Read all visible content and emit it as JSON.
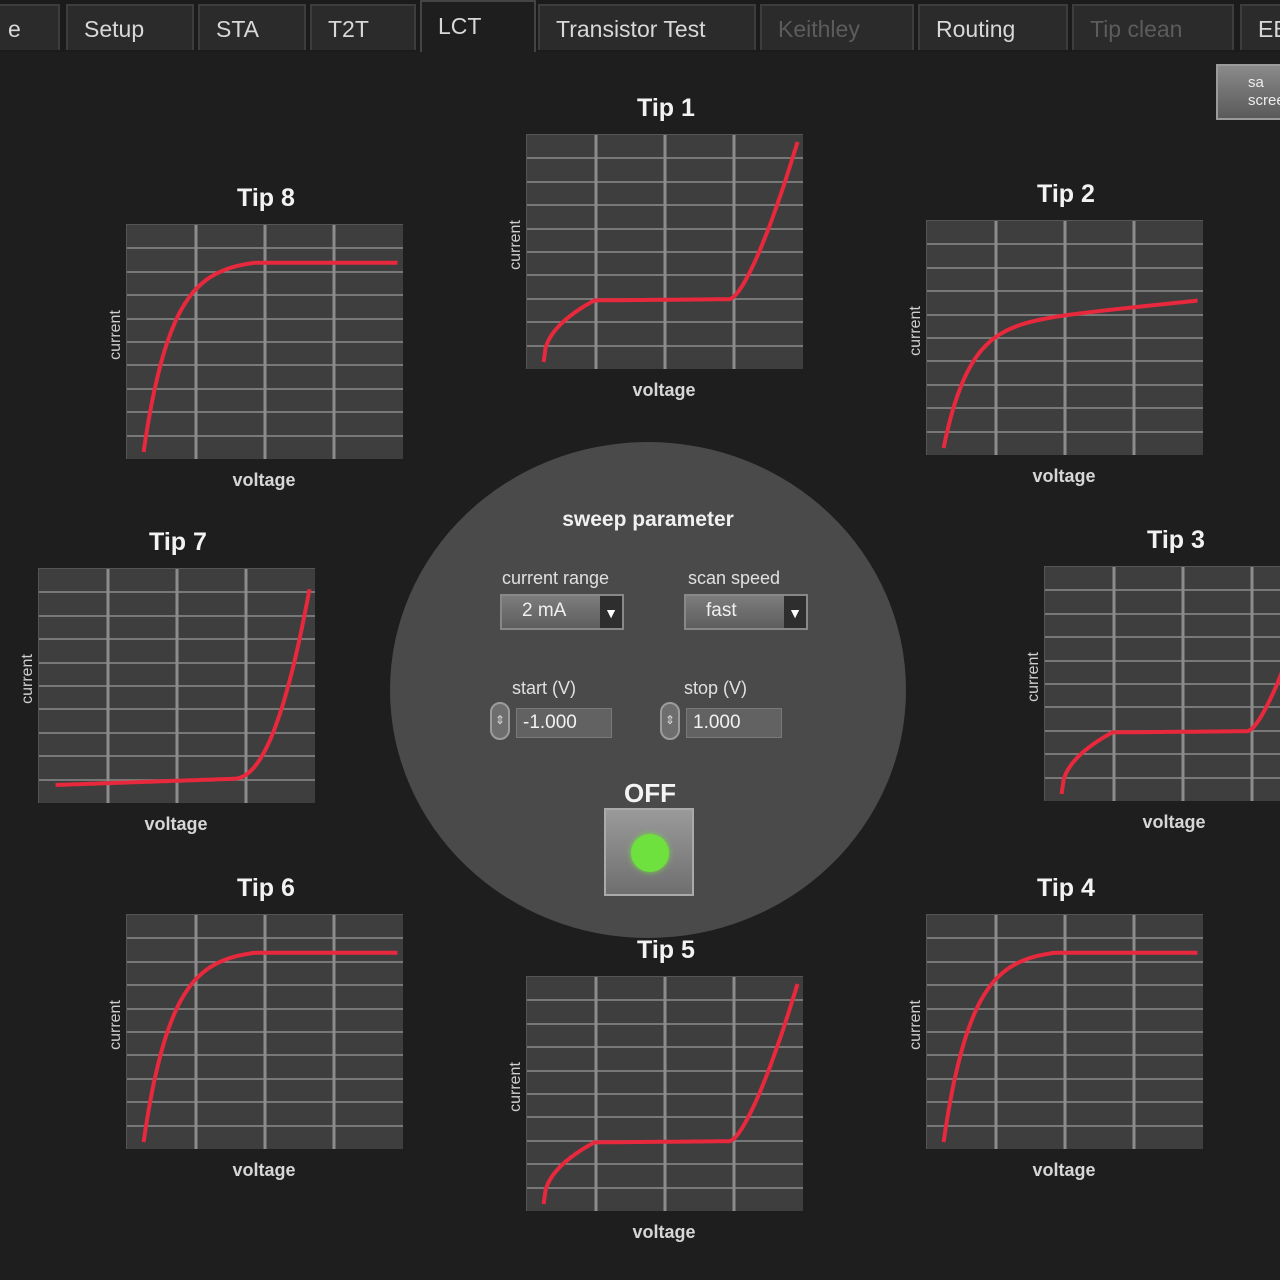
{
  "tabs": [
    {
      "label": "e",
      "state": "normal"
    },
    {
      "label": "Setup",
      "state": "normal"
    },
    {
      "label": "STA",
      "state": "normal"
    },
    {
      "label": "T2T",
      "state": "normal"
    },
    {
      "label": "LCT",
      "state": "active"
    },
    {
      "label": "Transistor Test",
      "state": "normal"
    },
    {
      "label": "Keithley",
      "state": "disabled"
    },
    {
      "label": "Routing",
      "state": "normal"
    },
    {
      "label": "Tip clean",
      "state": "disabled"
    },
    {
      "label": "EB",
      "state": "normal"
    }
  ],
  "save_button": {
    "label": "sa scree"
  },
  "tips": [
    {
      "title": "Tip 1",
      "ylabel": "current",
      "xlabel": "voltage",
      "curve": "symmetric"
    },
    {
      "title": "Tip 2",
      "ylabel": "current",
      "xlabel": "voltage",
      "curve": "saturating-sloped"
    },
    {
      "title": "Tip 3",
      "ylabel": "current",
      "xlabel": "voltage",
      "curve": "symmetric"
    },
    {
      "title": "Tip 4",
      "ylabel": "current",
      "xlabel": "voltage",
      "curve": "saturating"
    },
    {
      "title": "Tip 5",
      "ylabel": "current",
      "xlabel": "voltage",
      "curve": "symmetric"
    },
    {
      "title": "Tip 6",
      "ylabel": "current",
      "xlabel": "voltage",
      "curve": "saturating"
    },
    {
      "title": "Tip 7",
      "ylabel": "current",
      "xlabel": "voltage",
      "curve": "exponential"
    },
    {
      "title": "Tip 8",
      "ylabel": "current",
      "xlabel": "voltage",
      "curve": "saturating"
    }
  ],
  "sweep": {
    "title": "sweep parameter",
    "current_range": {
      "label": "current range",
      "value": "2 mA"
    },
    "scan_speed": {
      "label": "scan speed",
      "value": "fast"
    },
    "start": {
      "label": "start (V)",
      "value": "-1.000"
    },
    "stop": {
      "label": "stop (V)",
      "value": "1.000"
    },
    "power": {
      "label": "OFF",
      "led_color": "#6fe13f"
    }
  },
  "colors": {
    "trace": "#e8283c",
    "plot_bg": "#3e3e3e",
    "grid": "#8c8c8c"
  }
}
